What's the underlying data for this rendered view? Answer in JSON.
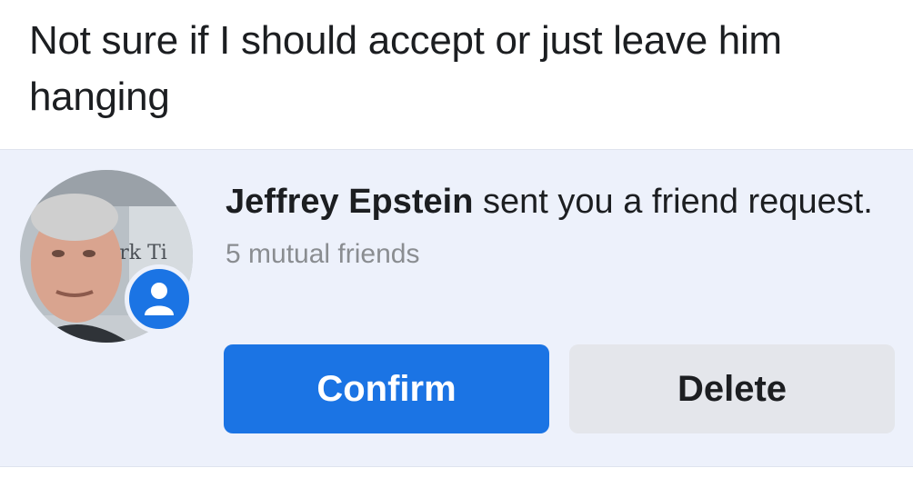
{
  "post": {
    "caption": "Not sure if I should accept or just leave him hanging"
  },
  "notification": {
    "sender_name": "Jeffrey Epstein",
    "message": " sent you a friend request.",
    "mutual_friends": "5 mutual friends",
    "avatar_background_text": "ork Ti",
    "badge_icon": "person-icon",
    "confirm_label": "Confirm",
    "delete_label": "Delete"
  },
  "colors": {
    "accent": "#1b74e4",
    "notification_bg": "#edf1fb",
    "secondary_button": "#e4e6eb",
    "muted_text": "#8a8d91"
  }
}
